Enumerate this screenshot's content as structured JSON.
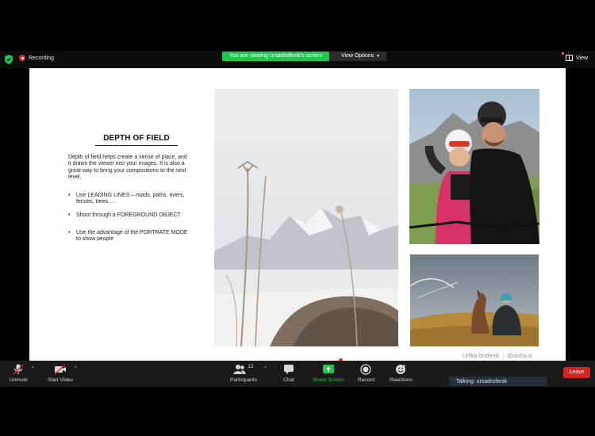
{
  "top_bar": {
    "recording_label": "Recording",
    "viewing_banner": "You are viewing ursadrofenik's screen",
    "view_options_label": "View Options",
    "view_label": "View"
  },
  "slide": {
    "title": "DEPTH OF FIELD",
    "intro": "Depth of field helps create a sense of place, and it draws the viewer into your images. It is also a great way to bring your compositions to the next level.",
    "bullets": [
      "Use LEADING LINES – roads, paths, rivers, fenses, trees, ...",
      "Shoot through a FOREGROUND OBJECT",
      "Use the advantage of the PORTRATE MODE to show people"
    ],
    "bullet_symbol": "•",
    "credit_name": "Urška Drofenik",
    "credit_separator": "|",
    "credit_handle": "@ursha.si"
  },
  "toolbar": {
    "unmute_label": "Unmute",
    "start_video_label": "Start Video",
    "participants_label": "Participants",
    "participants_count": "12",
    "chat_label": "Chat",
    "share_screen_label": "Share Screen",
    "record_label": "Record",
    "reactions_label": "Reactions",
    "leave_label": "Leave",
    "caret": "^"
  },
  "talking_indicator": "Talking: ursadrofenik",
  "colors": {
    "accent_green": "#23c552",
    "leave_red": "#d12525",
    "bar_dark": "#1a1a1a"
  }
}
